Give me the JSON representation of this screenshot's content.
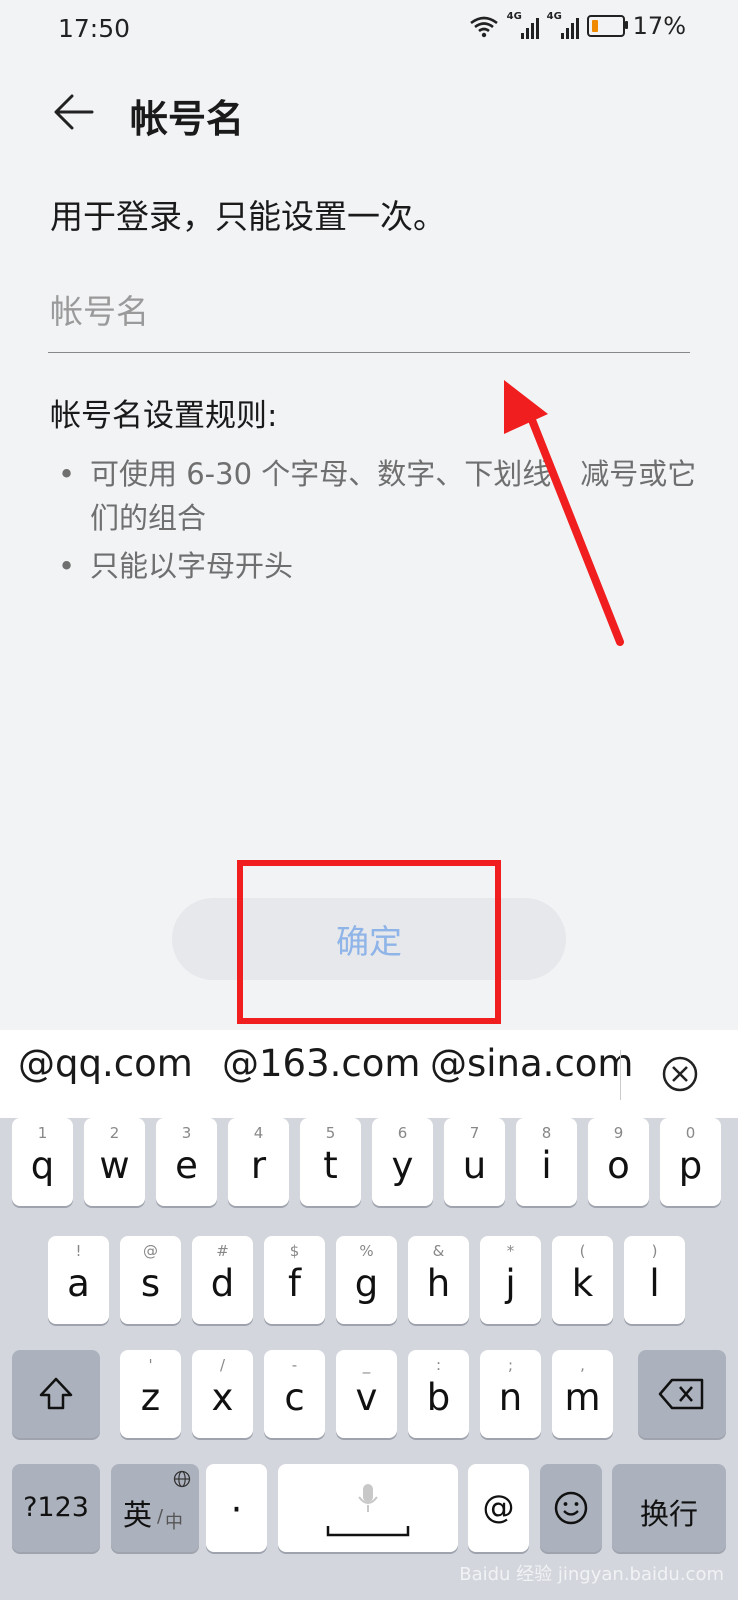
{
  "status_bar": {
    "time": "17:50",
    "battery_percent": "17%",
    "network_tags": [
      "4G",
      "4G"
    ],
    "battery_level": 0.17
  },
  "header": {
    "title": "帐号名"
  },
  "description": "用于登录，只能设置一次。",
  "username_field": {
    "placeholder": "帐号名",
    "value": ""
  },
  "rules": {
    "title": "帐号名设置规则:",
    "items": [
      "可使用 6-30 个字母、数字、下划线、减号或它们的组合",
      "只能以字母开头"
    ]
  },
  "confirm_button": {
    "label": "确定"
  },
  "colors": {
    "annotation": "#f01e1e",
    "button_text": "#8fb4e8"
  },
  "suggestions": [
    "@qq.com",
    "@163.com",
    "@sina.com"
  ],
  "keyboard": {
    "row1": [
      {
        "key": "q",
        "hint": "1"
      },
      {
        "key": "w",
        "hint": "2"
      },
      {
        "key": "e",
        "hint": "3"
      },
      {
        "key": "r",
        "hint": "4"
      },
      {
        "key": "t",
        "hint": "5"
      },
      {
        "key": "y",
        "hint": "6"
      },
      {
        "key": "u",
        "hint": "7"
      },
      {
        "key": "i",
        "hint": "8"
      },
      {
        "key": "o",
        "hint": "9"
      },
      {
        "key": "p",
        "hint": "0"
      }
    ],
    "row2": [
      {
        "key": "a",
        "hint": "!"
      },
      {
        "key": "s",
        "hint": "@"
      },
      {
        "key": "d",
        "hint": "#"
      },
      {
        "key": "f",
        "hint": "$"
      },
      {
        "key": "g",
        "hint": "%"
      },
      {
        "key": "h",
        "hint": "&"
      },
      {
        "key": "j",
        "hint": "*"
      },
      {
        "key": "k",
        "hint": "("
      },
      {
        "key": "l",
        "hint": ")"
      }
    ],
    "row3": [
      {
        "key": "z",
        "hint": "'"
      },
      {
        "key": "x",
        "hint": "/"
      },
      {
        "key": "c",
        "hint": "-"
      },
      {
        "key": "v",
        "hint": "_"
      },
      {
        "key": "b",
        "hint": ":"
      },
      {
        "key": "n",
        "hint": ";"
      },
      {
        "key": "m",
        "hint": ","
      }
    ],
    "numbers_key": "?123",
    "lang_key": "英",
    "lang_alt": "中",
    "period_key": "·",
    "at_key": "@",
    "enter_key": "换行"
  },
  "watermark": "Baidu 经验 jingyan.baidu.com"
}
